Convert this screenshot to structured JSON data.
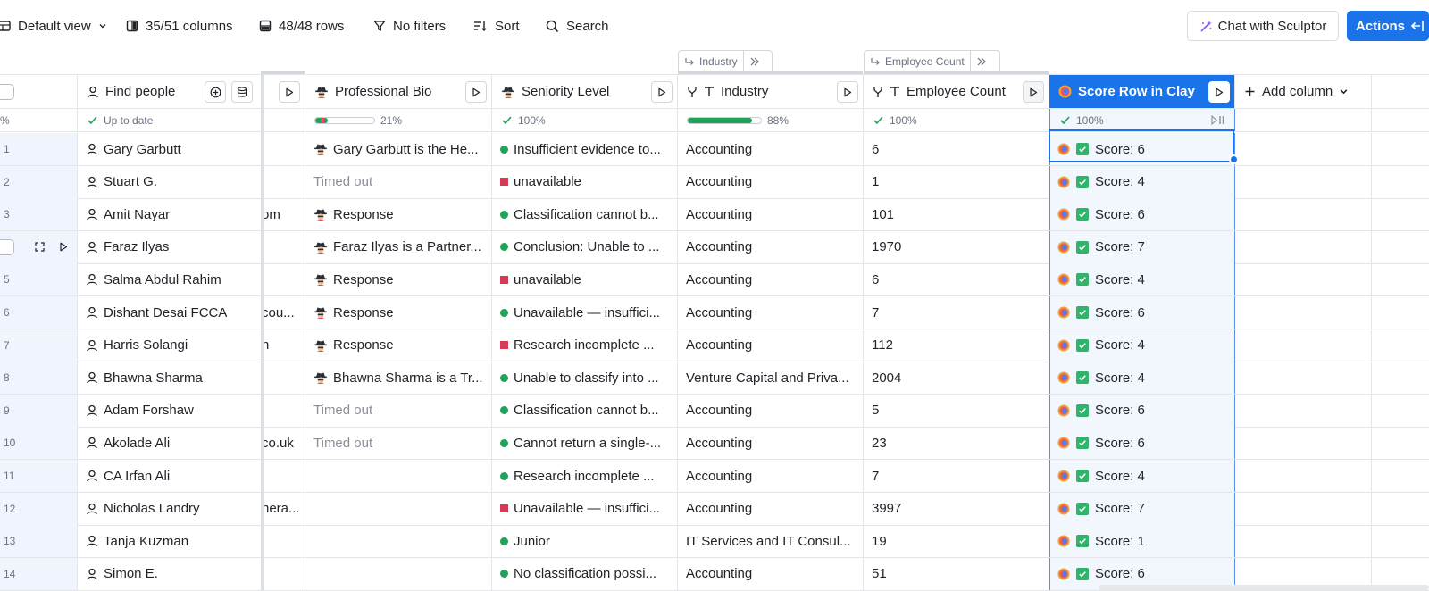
{
  "toolbar": {
    "view": "Default view",
    "columns": "35/51 columns",
    "rows": "48/48 rows",
    "filters": "No filters",
    "sort": "Sort",
    "search": "Search",
    "sculptor": "Chat with Sculptor",
    "actions": "Actions"
  },
  "groups": {
    "industry": "Industry",
    "employee_count": "Employee Count"
  },
  "columns": {
    "find_people": "Find people",
    "professional_bio": "Professional Bio",
    "seniority": "Seniority Level",
    "industry": "Industry",
    "employee_count": "Employee Count",
    "score": "Score Row in Clay",
    "add": "Add column"
  },
  "status": {
    "idx": "%",
    "find_people": "Up to date",
    "professional_bio": "21%",
    "seniority": "100%",
    "industry": "88%",
    "employee_count": "100%",
    "score": "100%"
  },
  "progress": {
    "professional_bio": 0.21,
    "industry": 0.88
  },
  "rows": [
    {
      "n": "1",
      "name": "Gary Garbutt",
      "mid": "",
      "bio": "Gary Garbutt is the He...",
      "bio_icon": true,
      "sen": "Insufficient evidence to...",
      "sen_kind": "dot",
      "ind": "Accounting",
      "emp": "6",
      "score": "Score: 6"
    },
    {
      "n": "2",
      "name": "Stuart G.",
      "mid": "",
      "bio": "Timed out",
      "bio_icon": false,
      "sen": "unavailable",
      "sen_kind": "sq",
      "ind": "Accounting",
      "emp": "1",
      "score": "Score: 4"
    },
    {
      "n": "3",
      "name": "Amit Nayar",
      "mid": "om",
      "bio": "Response",
      "bio_icon": true,
      "sen": "Classification cannot b...",
      "sen_kind": "dot",
      "ind": "Accounting",
      "emp": "101",
      "score": "Score: 6"
    },
    {
      "n": "",
      "name": "Faraz Ilyas",
      "mid": "",
      "bio": "Faraz Ilyas is a Partner...",
      "bio_icon": true,
      "sen": "Conclusion: Unable to ...",
      "sen_kind": "dot",
      "ind": "Accounting",
      "emp": "1970",
      "score": "Score: 7"
    },
    {
      "n": "5",
      "name": "Salma Abdul Rahim",
      "mid": "",
      "bio": "Response",
      "bio_icon": true,
      "sen": "unavailable",
      "sen_kind": "sq",
      "ind": "Accounting",
      "emp": "6",
      "score": "Score: 4"
    },
    {
      "n": "6",
      "name": "Dishant Desai FCCA",
      "mid": "cou...",
      "bio": "Response",
      "bio_icon": true,
      "sen": "Unavailable — insuffici...",
      "sen_kind": "dot",
      "ind": "Accounting",
      "emp": "7",
      "score": "Score: 6"
    },
    {
      "n": "7",
      "name": "Harris Solangi",
      "mid": "n",
      "bio": "Response",
      "bio_icon": true,
      "sen": "Research incomplete ...",
      "sen_kind": "sq",
      "ind": "Accounting",
      "emp": "112",
      "score": "Score: 4"
    },
    {
      "n": "8",
      "name": "Bhawna Sharma",
      "mid": "",
      "bio": "Bhawna Sharma is a Tr...",
      "bio_icon": true,
      "sen": "Unable to classify into ...",
      "sen_kind": "dot",
      "ind": "Venture Capital and Priva...",
      "emp": "2004",
      "score": "Score: 4"
    },
    {
      "n": "9",
      "name": "Adam Forshaw",
      "mid": "",
      "bio": "Timed out",
      "bio_icon": false,
      "sen": "Classification cannot b...",
      "sen_kind": "dot",
      "ind": "Accounting",
      "emp": "5",
      "score": "Score: 6"
    },
    {
      "n": "10",
      "name": "Akolade Ali",
      "mid": "co.uk",
      "bio": "Timed out",
      "bio_icon": false,
      "sen": "Cannot return a single-...",
      "sen_kind": "dot",
      "ind": "Accounting",
      "emp": "23",
      "score": "Score: 6"
    },
    {
      "n": "11",
      "name": "CA Irfan Ali",
      "mid": "",
      "bio": "",
      "bio_icon": false,
      "sen": "Research incomplete ...",
      "sen_kind": "dot",
      "ind": "Accounting",
      "emp": "7",
      "score": "Score: 4"
    },
    {
      "n": "12",
      "name": "Nicholas Landry",
      "mid": "nera...",
      "bio": "",
      "bio_icon": false,
      "sen": "Unavailable — insuffici...",
      "sen_kind": "sq",
      "ind": "Accounting",
      "emp": "3997",
      "score": "Score: 7"
    },
    {
      "n": "13",
      "name": "Tanja Kuzman",
      "mid": "",
      "bio": "",
      "bio_icon": false,
      "sen": "Junior",
      "sen_kind": "dot",
      "ind": "IT Services and IT Consul...",
      "emp": "19",
      "score": "Score: 1"
    },
    {
      "n": "14",
      "name": "Simon E.",
      "mid": "",
      "bio": "",
      "bio_icon": false,
      "sen": "No classification possi...",
      "sen_kind": "dot",
      "ind": "Accounting",
      "emp": "51",
      "score": "Score: 6"
    }
  ]
}
